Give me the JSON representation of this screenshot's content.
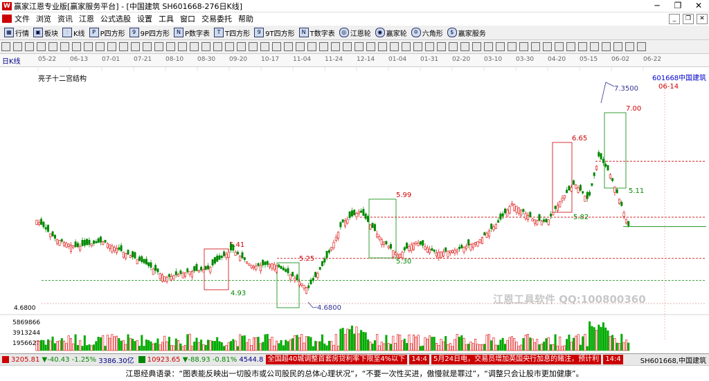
{
  "window": {
    "title": "赢家江恩专业版[赢家服务平台] - [中国建筑  SH601668-276日K线]"
  },
  "menu": [
    "文件",
    "浏览",
    "资讯",
    "江恩",
    "公式选股",
    "设置",
    "工具",
    "窗口",
    "交易委托",
    "帮助"
  ],
  "toolbar1": [
    "行情",
    "板块",
    "K线",
    "P四方形",
    "9P四方形",
    "P数字表",
    "T四方形",
    "9T四方形",
    "T数字表",
    "江恩轮",
    "赢家轮",
    "六角形",
    "赢家服务"
  ],
  "chart": {
    "period_label": "日K线",
    "indicator_label": "亮子十二宫结构",
    "stock_code": "601668",
    "stock_name": "中国建筑",
    "last_date": "06-14",
    "price_labels": [
      "7.3500",
      "7.00",
      "6.65",
      "5.99",
      "5.82",
      "5.41",
      "5.30",
      "5.25",
      "4.93",
      "4.6800",
      "4.6800",
      "5.11"
    ],
    "left_low": "4.6800",
    "volume_ticks": [
      "5869866",
      "3913244",
      "1956622"
    ],
    "watermark": "江恩工具软件  QQ:100800360",
    "dates": [
      "05-22",
      "06-13",
      "07-01",
      "07-21",
      "08-10",
      "08-30",
      "09-20",
      "10-17",
      "11-04",
      "11-24",
      "12-14",
      "01-04",
      "01-31",
      "02-20",
      "03-10",
      "03-30",
      "04-20",
      "05-15",
      "06-02",
      "06-22"
    ]
  },
  "chart_data": {
    "type": "candlestick",
    "price_levels": [
      7.35,
      7.0,
      6.65,
      5.99,
      5.82,
      5.41,
      5.3,
      5.25,
      4.93,
      4.68,
      5.11
    ],
    "volume_ticks": [
      5869866,
      3913244,
      1956622
    ]
  },
  "status": {
    "sh_index": "3205.81",
    "sh_change": "▼-40.43",
    "sh_pct": "-1.25%",
    "sh_amount": "3386.30亿",
    "sz_index": "10923.65",
    "sz_change": "▼-88.93",
    "sz_pct": "-0.81%",
    "sz_amount": "4544.8",
    "news1": "全国超40城调整首套房贷利率下限至4%以下",
    "time1": "14:4",
    "news2": "5月24日电，交易员增加英国央行加息的赌注，预计利",
    "time2": "14:4",
    "stock": "SH601668,中国建筑"
  },
  "quote": "江恩经典语录：“图表能反映出一切股市或公司股民的总体心理状况”，“不要一次性买进，傲慢就是罪过”，“调整只会让股市更加健康”。"
}
